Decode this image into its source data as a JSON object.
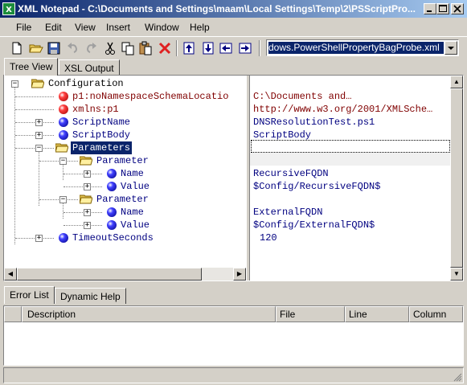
{
  "window": {
    "title": "XML Notepad - C:\\Documents and Settings\\maam\\Local Settings\\Temp\\2\\PSScriptPro...",
    "caption_buttons": [
      "minimize",
      "maximize",
      "close"
    ]
  },
  "menu": {
    "items": [
      {
        "label": "File"
      },
      {
        "label": "Edit"
      },
      {
        "label": "View"
      },
      {
        "label": "Insert"
      },
      {
        "label": "Window"
      },
      {
        "label": "Help"
      }
    ]
  },
  "toolbar": {
    "buttons": [
      "new-file-icon",
      "open-folder-icon",
      "save-icon",
      "undo-icon",
      "redo-icon",
      "cut-icon",
      "copy-icon",
      "paste-icon",
      "delete-icon",
      "nudge-up-icon",
      "nudge-down-icon",
      "nudge-left-icon",
      "nudge-right-icon"
    ],
    "xpath_value": "dows.PowerShellPropertyBagProbe.xml"
  },
  "tabs": {
    "main": [
      {
        "label": "Tree View"
      },
      {
        "label": "XSL Output"
      }
    ],
    "bottom": [
      {
        "label": "Error List"
      },
      {
        "label": "Dynamic Help"
      }
    ]
  },
  "tree": {
    "nodes": [
      {
        "label": "Configuration",
        "icon": "folder-open-icon",
        "value": ""
      },
      {
        "label": "p1:noNamespaceSchemaLocatio",
        "icon": "attribute-icon",
        "value": "C:\\Documents and…"
      },
      {
        "label": "xmlns:p1",
        "icon": "attribute-icon",
        "value": "http://www.w3.org/2001/XMLSche…"
      },
      {
        "label": "ScriptName",
        "icon": "element-icon",
        "value": "DNSResolutionTest.ps1"
      },
      {
        "label": "ScriptBody",
        "icon": "element-icon",
        "value": "ScriptBody"
      },
      {
        "label": "Parameters",
        "icon": "folder-open-icon",
        "value": ""
      },
      {
        "label": "Parameter",
        "icon": "folder-open-icon",
        "value": ""
      },
      {
        "label": "Name",
        "icon": "element-icon",
        "value": "RecursiveFQDN"
      },
      {
        "label": "Value",
        "icon": "element-icon",
        "value": "$Config/RecursiveFQDN$"
      },
      {
        "label": "Parameter",
        "icon": "folder-open-icon",
        "value": ""
      },
      {
        "label": "Name",
        "icon": "element-icon",
        "value": "ExternalFQDN"
      },
      {
        "label": "Value",
        "icon": "element-icon",
        "value": "$Config/ExternalFQDN$"
      },
      {
        "label": "TimeoutSeconds",
        "icon": "element-icon",
        "value": "120"
      }
    ]
  },
  "error_list": {
    "columns": [
      "Description",
      "File",
      "Line",
      "Column"
    ]
  },
  "colors": {
    "titlebar_start": "#0a246a",
    "titlebar_end": "#a6caf0",
    "selection": "#0a246a",
    "tree_text": "#000080",
    "attribute_text": "#800000"
  }
}
